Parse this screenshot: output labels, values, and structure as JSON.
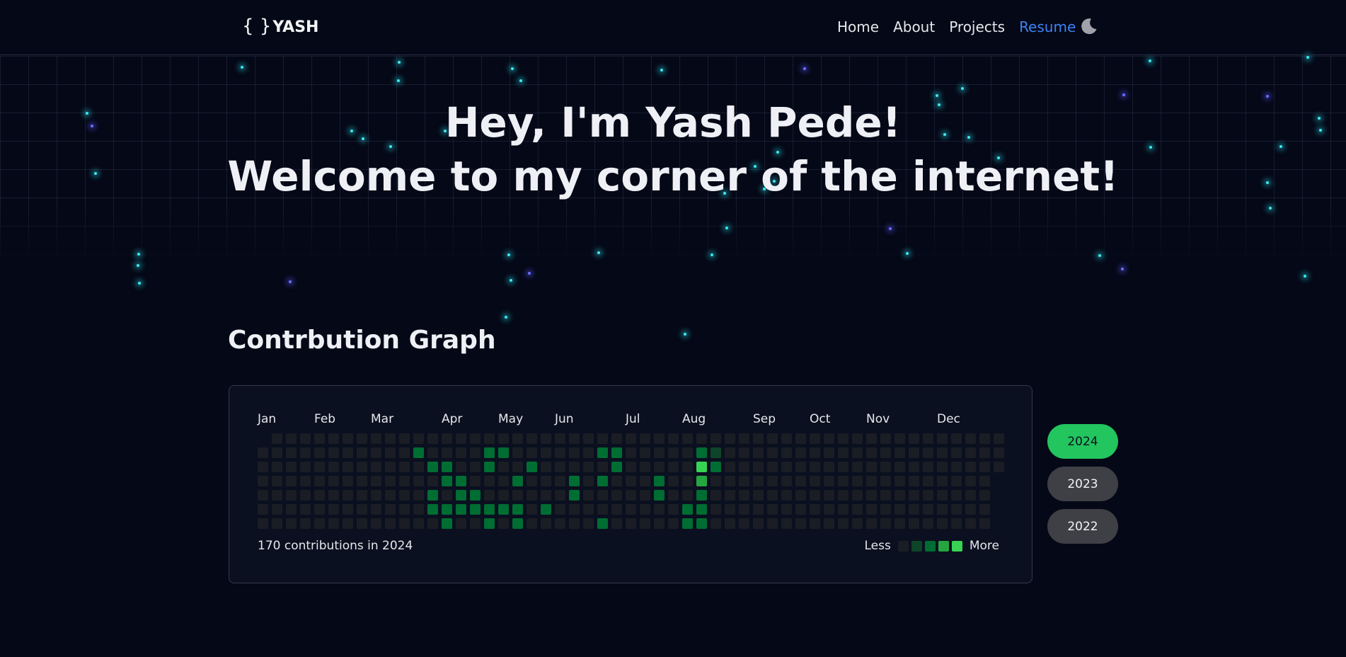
{
  "nav": {
    "logo_brace": "{ }",
    "logo_text": "YASH",
    "links": [
      "Home",
      "About",
      "Projects",
      "Resume"
    ],
    "active_link": "Resume",
    "theme_toggle_icon": "moon-icon"
  },
  "hero": {
    "line1": "Hey, I'm Yash Pede!",
    "line2": "Welcome to my corner of the internet!"
  },
  "contrib": {
    "section_title": "Contrbution Graph",
    "months": [
      "Jan",
      "Feb",
      "Mar",
      "Apr",
      "May",
      "Jun",
      "Jul",
      "Aug",
      "Sep",
      "Oct",
      "Nov",
      "Dec"
    ],
    "summary": "170 contributions in 2024",
    "legend_less": "Less",
    "legend_more": "More",
    "level_colors": [
      "#1a1d24",
      "#0e4429",
      "#006d32",
      "#26a641",
      "#39d353"
    ],
    "years": [
      "2024",
      "2023",
      "2022"
    ],
    "selected_year": "2024",
    "active_days": [
      {
        "week": 11,
        "day": 1,
        "level": 2
      },
      {
        "week": 12,
        "day": 2,
        "level": 2
      },
      {
        "week": 12,
        "day": 4,
        "level": 2
      },
      {
        "week": 12,
        "day": 5,
        "level": 2
      },
      {
        "week": 13,
        "day": 2,
        "level": 2
      },
      {
        "week": 13,
        "day": 3,
        "level": 2
      },
      {
        "week": 13,
        "day": 5,
        "level": 2
      },
      {
        "week": 13,
        "day": 6,
        "level": 2
      },
      {
        "week": 14,
        "day": 3,
        "level": 2
      },
      {
        "week": 14,
        "day": 4,
        "level": 2
      },
      {
        "week": 14,
        "day": 5,
        "level": 2
      },
      {
        "week": 15,
        "day": 4,
        "level": 2
      },
      {
        "week": 15,
        "day": 5,
        "level": 2
      },
      {
        "week": 16,
        "day": 1,
        "level": 2
      },
      {
        "week": 16,
        "day": 2,
        "level": 2
      },
      {
        "week": 16,
        "day": 5,
        "level": 2
      },
      {
        "week": 16,
        "day": 6,
        "level": 2
      },
      {
        "week": 16,
        "day": 7,
        "level": 2
      },
      {
        "week": 17,
        "day": 1,
        "level": 2
      },
      {
        "week": 17,
        "day": 5,
        "level": 2
      },
      {
        "week": 18,
        "day": 3,
        "level": 2
      },
      {
        "week": 18,
        "day": 5,
        "level": 2
      },
      {
        "week": 18,
        "day": 6,
        "level": 2
      },
      {
        "week": 19,
        "day": 2,
        "level": 2
      },
      {
        "week": 20,
        "day": 5,
        "level": 2
      },
      {
        "week": 22,
        "day": 3,
        "level": 2
      },
      {
        "week": 22,
        "day": 4,
        "level": 2
      },
      {
        "week": 23,
        "day": 7,
        "level": 2
      },
      {
        "week": 24,
        "day": 1,
        "level": 2
      },
      {
        "week": 24,
        "day": 3,
        "level": 2
      },
      {
        "week": 24,
        "day": 6,
        "level": 2
      },
      {
        "week": 24,
        "day": 7,
        "level": 2
      },
      {
        "week": 25,
        "day": 1,
        "level": 2
      },
      {
        "week": 25,
        "day": 2,
        "level": 2
      },
      {
        "week": 28,
        "day": 3,
        "level": 2
      },
      {
        "week": 28,
        "day": 4,
        "level": 2
      },
      {
        "week": 30,
        "day": 5,
        "level": 2
      },
      {
        "week": 30,
        "day": 6,
        "level": 2
      },
      {
        "week": 30,
        "day": 7,
        "level": 4
      },
      {
        "week": 31,
        "day": 1,
        "level": 2
      },
      {
        "week": 31,
        "day": 2,
        "level": 4
      },
      {
        "week": 31,
        "day": 3,
        "level": 3
      },
      {
        "week": 31,
        "day": 4,
        "level": 2
      },
      {
        "week": 31,
        "day": 5,
        "level": 2
      },
      {
        "week": 31,
        "day": 6,
        "level": 2
      },
      {
        "week": 32,
        "day": 1,
        "level": 1
      },
      {
        "week": 32,
        "day": 2,
        "level": 2
      }
    ]
  }
}
